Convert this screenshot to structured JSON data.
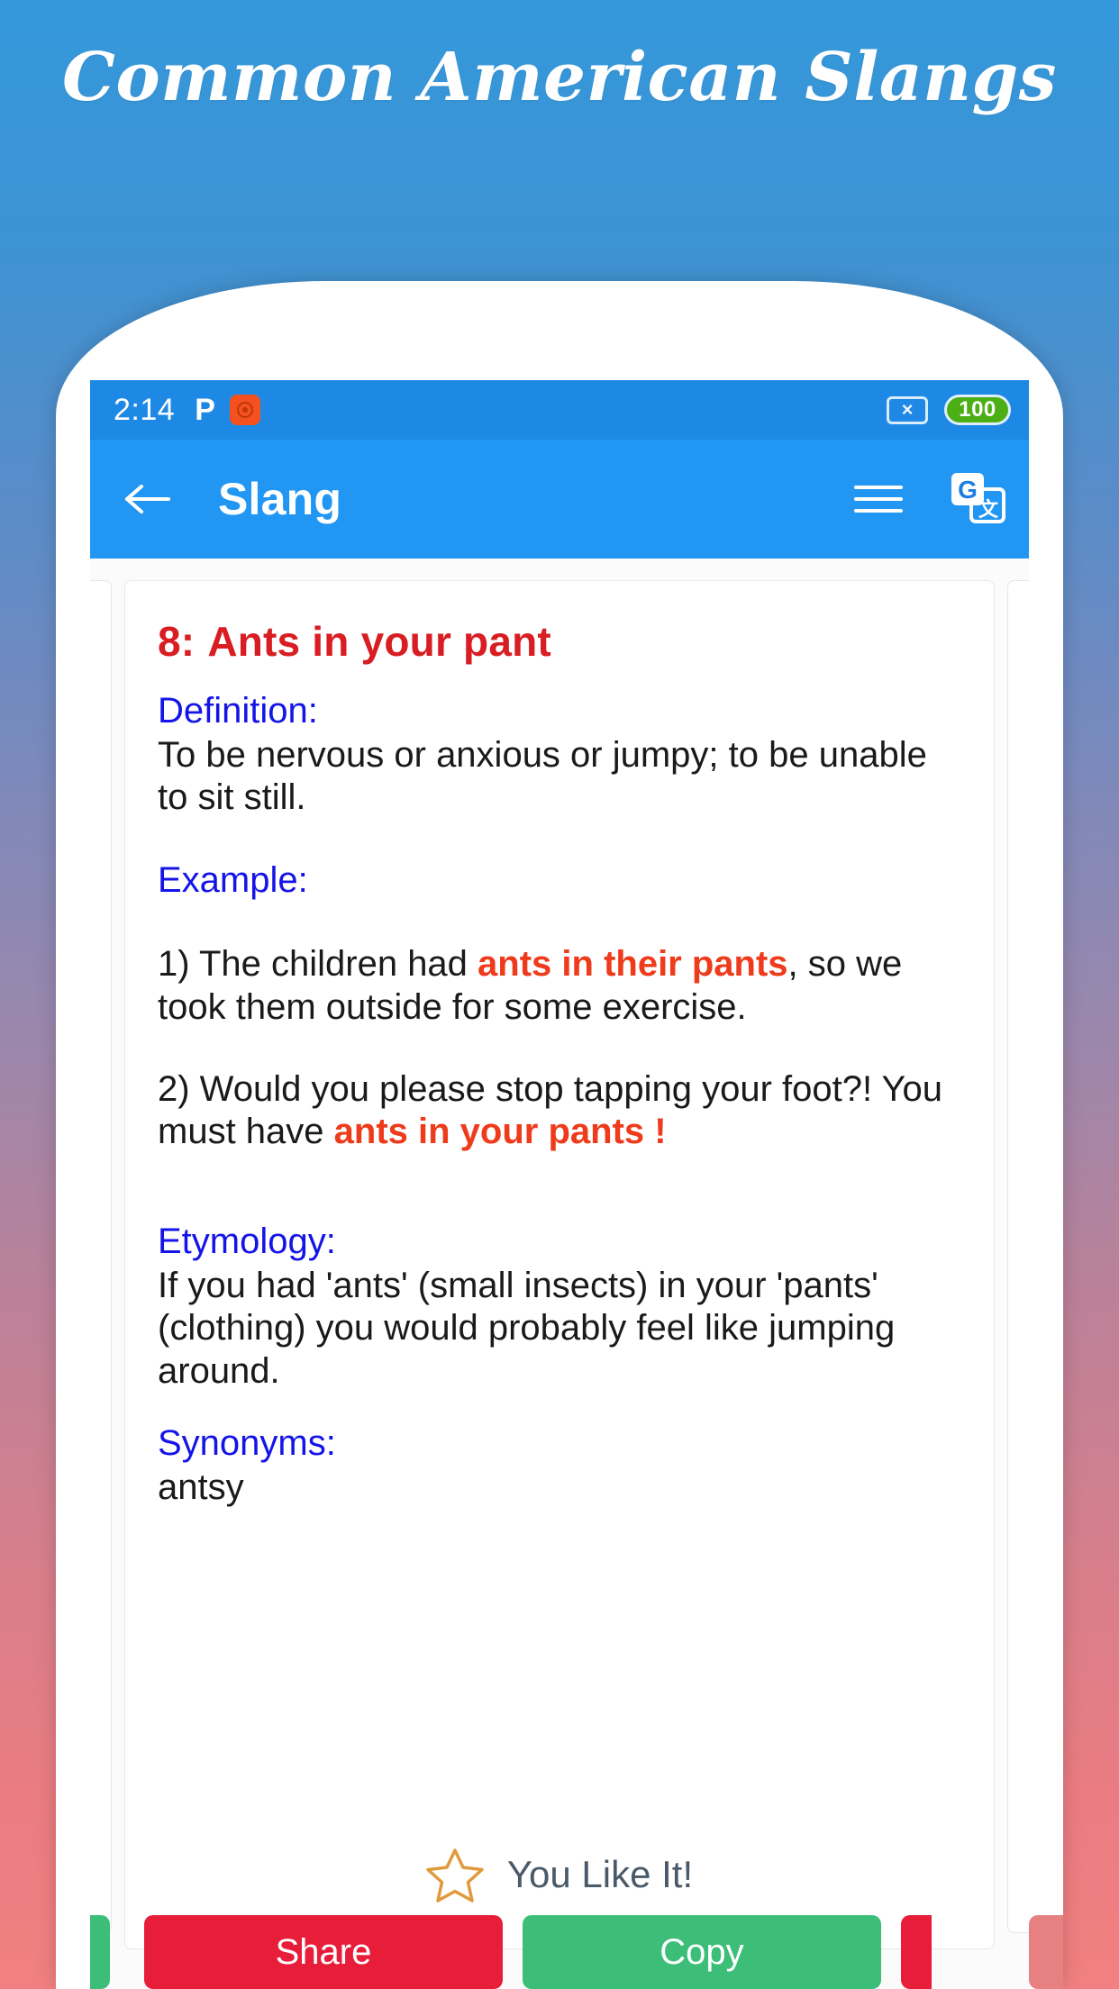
{
  "page": {
    "heading": "Common American Slangs",
    "background_top_color": "#3498db",
    "background_bottom_color": "#f28080"
  },
  "status_bar": {
    "time": "2:14",
    "p_icon_label": "P",
    "app_icon_name": "orange-app-icon",
    "no_sim_label": "×",
    "battery_level": "100",
    "battery_color": "#4caf16",
    "background_color": "#1e88e5"
  },
  "app_bar": {
    "back_label": "←",
    "title": "Slang",
    "menu_icon_name": "list-lines-icon",
    "translate_icon_name": "google-translate-icon",
    "background_color": "#2196f3"
  },
  "card": {
    "entry_number": "8:",
    "entry_title": "Ants in your pant",
    "title_color": "#d81d23",
    "label_color": "#1414e8",
    "highlight_color": "#ee3b1b",
    "definition_label": "Definition:",
    "definition_text": "To be nervous or anxious or jumpy; to be unable to sit still.",
    "example_label": "Example:",
    "example_1_pre": "1) The children had ",
    "example_1_highlight": "ants in their pants",
    "example_1_post": ", so we took them outside for some exercise.",
    "example_2_pre": "2) Would you please stop tapping your foot?! You must have ",
    "example_2_highlight": "ants in your pants !",
    "example_2_post": "",
    "etymology_label": "Etymology:",
    "etymology_text": "If you had 'ants' (small insects) in your 'pants' (clothing) you would probably feel like jumping around.",
    "synonyms_label": "Synonyms:",
    "synonyms_text": "antsy"
  },
  "like_row": {
    "star_icon_name": "star-outline-icon",
    "star_color": "#e09a3c",
    "text": "You Like It!",
    "text_color": "#4a5a68"
  },
  "actions": {
    "share_label": "Share",
    "share_color": "#e71d3a",
    "copy_label": "Copy",
    "copy_color": "#3cbe78"
  }
}
